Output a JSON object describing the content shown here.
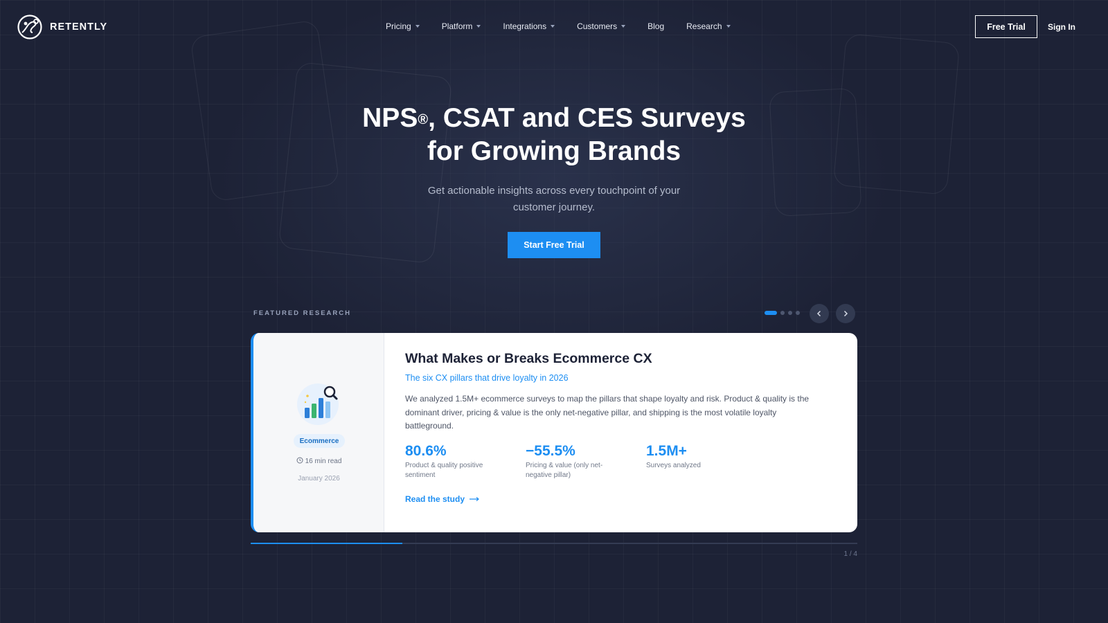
{
  "brand": {
    "name": "RETENTLY"
  },
  "nav": {
    "items": [
      {
        "label": "Pricing",
        "has_dropdown": true
      },
      {
        "label": "Platform",
        "has_dropdown": true
      },
      {
        "label": "Integrations",
        "has_dropdown": true
      },
      {
        "label": "Customers",
        "has_dropdown": true
      },
      {
        "label": "Blog",
        "has_dropdown": false
      },
      {
        "label": "Research",
        "has_dropdown": true
      }
    ],
    "free_trial_label": "Free Trial",
    "sign_in_label": "Sign In"
  },
  "hero": {
    "title_part1": "NPS",
    "title_sup": "®",
    "title_part2": ", CSAT and CES Surveys",
    "title_line2": "for Growing Brands",
    "subtitle": "Get actionable insights across every touchpoint of your customer journey.",
    "cta_label": "Start Free Trial"
  },
  "featured": {
    "section_label": "FEATURED RESEARCH",
    "slide_count": 4,
    "active_slide": 1,
    "progress_fraction": 0.25,
    "page_indicator": "1 / 4",
    "card": {
      "category": "Ecommerce",
      "read_time": "16 min read",
      "date": "January 2026",
      "title": "What Makes or Breaks Ecommerce CX",
      "subtitle": "The six CX pillars that drive loyalty in 2026",
      "description": "We analyzed 1.5M+ ecommerce surveys to map the pillars that shape loyalty and risk. Product & quality is the dominant driver, pricing & value is the only net-negative pillar, and shipping is the most volatile loyalty battleground.",
      "stats": [
        {
          "value": "80.6%",
          "label": "Product & quality positive sentiment"
        },
        {
          "value": "−55.5%",
          "label": "Pricing & value (only net-negative pillar)"
        },
        {
          "value": "1.5M+",
          "label": "Surveys analyzed"
        }
      ],
      "link_label": "Read the study"
    }
  },
  "colors": {
    "accent": "#1d8ef2",
    "background": "#1d2236",
    "card": "#ffffff"
  },
  "icons": [
    "retently-logo-icon",
    "chevron-down-icon",
    "chevron-left-icon",
    "chevron-right-icon",
    "clock-icon",
    "chart-search-icon",
    "arrow-right-icon"
  ]
}
